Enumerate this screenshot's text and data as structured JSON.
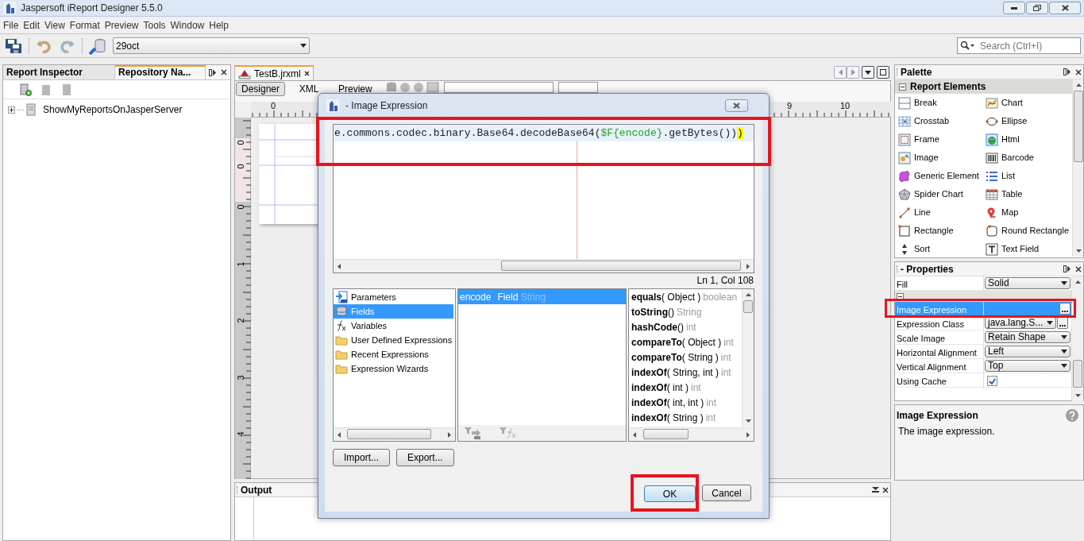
{
  "window": {
    "title": "Jaspersoft iReport Designer 5.5.0"
  },
  "menu": [
    "File",
    "Edit",
    "View",
    "Format",
    "Preview",
    "Tools",
    "Window",
    "Help"
  ],
  "toolbar": {
    "datasource": "29oct",
    "search_placeholder": "Search (Ctrl+I)"
  },
  "left_panel": {
    "tabs": [
      {
        "label": "Report Inspector",
        "selected": false
      },
      {
        "label": "Repository Na...",
        "selected": true
      }
    ],
    "tree": [
      {
        "label": "ShowMyReportsOnJasperServer",
        "expanded": false
      }
    ]
  },
  "editor": {
    "tabs": [
      {
        "label": "TestB.jrxml",
        "selected": true
      }
    ],
    "views": [
      {
        "label": "Designer",
        "selected": true
      },
      {
        "label": "XML",
        "selected": false
      },
      {
        "label": "Preview",
        "selected": false
      }
    ],
    "top_ruler": [
      "0",
      "9",
      "10"
    ],
    "side_ruler": [
      "0",
      "0",
      "0",
      "1",
      "2",
      "3",
      "4"
    ]
  },
  "output": {
    "title": "Output"
  },
  "palette": {
    "title": "Palette",
    "group": "Report Elements",
    "expanded": true,
    "items": [
      {
        "label": "Break",
        "kind": "break"
      },
      {
        "label": "Chart",
        "kind": "chart"
      },
      {
        "label": "Crosstab",
        "kind": "crosstab"
      },
      {
        "label": "Ellipse",
        "kind": "ellipse"
      },
      {
        "label": "Frame",
        "kind": "frame"
      },
      {
        "label": "Html",
        "kind": "html"
      },
      {
        "label": "Image",
        "kind": "image"
      },
      {
        "label": "Barcode",
        "kind": "barcode"
      },
      {
        "label": "Generic Element",
        "kind": "generic"
      },
      {
        "label": "List",
        "kind": "list"
      },
      {
        "label": "Spider Chart",
        "kind": "spider"
      },
      {
        "label": "Table",
        "kind": "table"
      },
      {
        "label": "Line",
        "kind": "line"
      },
      {
        "label": "Map",
        "kind": "map"
      },
      {
        "label": "Rectangle",
        "kind": "rectangle"
      },
      {
        "label": "Round Rectangle",
        "kind": "round-rectangle"
      },
      {
        "label": "Sort",
        "kind": "sort"
      },
      {
        "label": "Text Field",
        "kind": "text-field"
      }
    ]
  },
  "properties": {
    "title": "- Properties",
    "rows": [
      {
        "kind": "dropdown",
        "label": "Fill",
        "value": "Solid",
        "selected": false
      },
      {
        "kind": "group",
        "expanded": true
      },
      {
        "kind": "button",
        "label": "Image Expression",
        "selected": true,
        "highlighted": true
      },
      {
        "kind": "dropdown-button",
        "label": "Expression Class",
        "value": "java.lang.S...",
        "selected": false
      },
      {
        "kind": "dropdown",
        "label": "Scale Image",
        "value": "Retain Shape",
        "selected": false
      },
      {
        "kind": "dropdown",
        "label": "Horizontal Alignment",
        "value": "Left",
        "selected": false
      },
      {
        "kind": "dropdown",
        "label": "Vertical Alignment",
        "value": "Top",
        "selected": false
      },
      {
        "kind": "checkbox",
        "label": "Using Cache",
        "checked": true,
        "selected": false
      }
    ],
    "help": {
      "title": "Image Expression",
      "text": "The image expression."
    }
  },
  "dialog": {
    "title": "- Image Expression",
    "expression": {
      "highlighted": true,
      "segments": [
        {
          "kind": "plain",
          "text": "e.commons.codec.binary.Base64.decodeBase64("
        },
        {
          "kind": "field",
          "text": "$F{encode}"
        },
        {
          "kind": "plain",
          "text": ".getBytes())"
        },
        {
          "kind": "match",
          "text": ")"
        }
      ]
    },
    "caret_position": "Ln 1, Col 108",
    "categories": [
      {
        "label": "Parameters",
        "kind": "parameters",
        "selected": false
      },
      {
        "label": "Fields",
        "kind": "fields",
        "selected": true
      },
      {
        "label": "Variables",
        "kind": "variables",
        "selected": false
      },
      {
        "label": "User Defined Expressions",
        "kind": "folder",
        "selected": false
      },
      {
        "label": "Recent Expressions",
        "kind": "folder",
        "selected": false
      },
      {
        "label": "Expression Wizards",
        "kind": "folder",
        "selected": false
      }
    ],
    "objects": [
      {
        "name": "encode",
        "type_label": "Field",
        "class": "String",
        "selected": true
      }
    ],
    "methods": [
      {
        "name": "equals",
        "params": "( Object )",
        "returns": "boolean"
      },
      {
        "name": "toString",
        "params": "()",
        "returns": "String"
      },
      {
        "name": "hashCode",
        "params": "()",
        "returns": "int"
      },
      {
        "name": "compareTo",
        "params": "( Object )",
        "returns": "int"
      },
      {
        "name": "compareTo",
        "params": "( String )",
        "returns": "int"
      },
      {
        "name": "indexOf",
        "params": "( String, int )",
        "returns": "int"
      },
      {
        "name": "indexOf",
        "params": "( int )",
        "returns": "int"
      },
      {
        "name": "indexOf",
        "params": "( int, int )",
        "returns": "int"
      },
      {
        "name": "indexOf",
        "params": "( String )",
        "returns": "int"
      }
    ],
    "buttons": [
      {
        "label": "Import..."
      },
      {
        "label": "Export..."
      }
    ],
    "actions": [
      {
        "label": "OK",
        "default": true,
        "highlighted": true
      },
      {
        "label": "Cancel",
        "default": false,
        "highlighted": false
      }
    ]
  }
}
